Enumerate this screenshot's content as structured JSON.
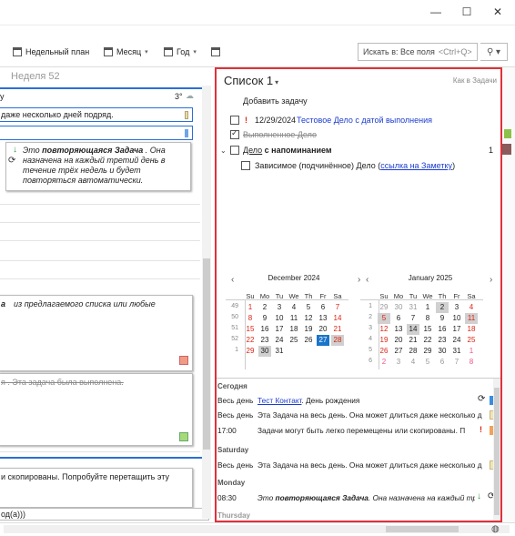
{
  "window": {
    "minimize": "—",
    "maximize": "☐",
    "close": "✕"
  },
  "toolbar": {
    "week_plan": "Недельный план",
    "month": "Месяц",
    "year": "Год",
    "search_placeholder": "Искать в: Все поля",
    "search_shortcut": "<Ctrl+Q>"
  },
  "left": {
    "week_label": "Неделя 52",
    "temp": "3°",
    "line1": "даже несколько дней подряд.",
    "recurring_1": "Это",
    "recurring_bold": "повторяющаяся Задача",
    "recurring_2": ". Она",
    "recurring_3": "назначена на каждый третий день в",
    "recurring_4": "течение трёх недель и будет",
    "recurring_5": "повторяться автоматически.",
    "box2_a": "а",
    "box2_b": "из предлагаемого списка или любые",
    "box3": "я . Эта задача была выполнена.",
    "box4": "и скопированы. Попробуйте перетащить эту",
    "bottom_field": "од(а)))"
  },
  "list": {
    "title": "Список 1",
    "view": "Как в Задачи",
    "add_task": "Добавить задачу",
    "tasks": [
      {
        "date": "12/29/2024",
        "title": "Тестовое Дело с датой выполнения"
      },
      {
        "title": "Выполненное Дело"
      },
      {
        "title_pre": "Дело",
        "title_bold": " с напоминанием",
        "count": "1"
      },
      {
        "title": "Зависимое (подчинённое) Дело (",
        "link": "ссылка на Заметку",
        "end": ")"
      }
    ]
  },
  "calendar": {
    "dec_title": "December  2024",
    "jan_title": "January  2025",
    "dow": [
      "Su",
      "Mo",
      "Tu",
      "We",
      "Th",
      "Fr",
      "Sa"
    ],
    "dec_weeks": [
      "49",
      "50",
      "51",
      "52",
      "1"
    ],
    "dec_rows": [
      [
        "1",
        "2",
        "3",
        "4",
        "5",
        "6",
        "7"
      ],
      [
        "8",
        "9",
        "10",
        "11",
        "12",
        "13",
        "14"
      ],
      [
        "15",
        "16",
        "17",
        "18",
        "19",
        "20",
        "21"
      ],
      [
        "22",
        "23",
        "24",
        "25",
        "26",
        "27",
        "28"
      ],
      [
        "29",
        "30",
        "31",
        "",
        "",
        "",
        ""
      ]
    ],
    "jan_weeks": [
      "1",
      "2",
      "3",
      "4",
      "5",
      "6"
    ],
    "jan_rows": [
      [
        "29",
        "30",
        "31",
        "1",
        "2",
        "3",
        "4"
      ],
      [
        "5",
        "6",
        "7",
        "8",
        "9",
        "10",
        "11"
      ],
      [
        "12",
        "13",
        "14",
        "15",
        "16",
        "17",
        "18"
      ],
      [
        "19",
        "20",
        "21",
        "22",
        "23",
        "24",
        "25"
      ],
      [
        "26",
        "27",
        "28",
        "29",
        "30",
        "31",
        "1"
      ],
      [
        "2",
        "3",
        "4",
        "5",
        "6",
        "7",
        "8"
      ]
    ]
  },
  "agenda": {
    "today": "Сегодня",
    "r1_time": "Весь день",
    "r1_link": "Тест Контакт",
    "r1_text": ". День рождения",
    "r2_time": "Весь день",
    "r2_text": "Эта Задача на весь день. Она может длиться даже несколько д",
    "r3_time": "17:00",
    "r3_text": "Задачи могут быть легко перемещены или скопированы. П",
    "saturday": "Saturday",
    "r4_time": "Весь день",
    "r4_text": "Эта Задача на весь день. Она может длиться даже несколько д",
    "monday": "Monday",
    "r5_time": "08:30",
    "r5_pre": "Это ",
    "r5_bold": "повторяющаяся Задача",
    "r5_text": ". Она назначена на каждый тре",
    "thursday": "Thursday"
  },
  "colors": {
    "accent_red": "#e0313a",
    "today_blue": "#1a74c9",
    "link": "#1b3ccf"
  }
}
